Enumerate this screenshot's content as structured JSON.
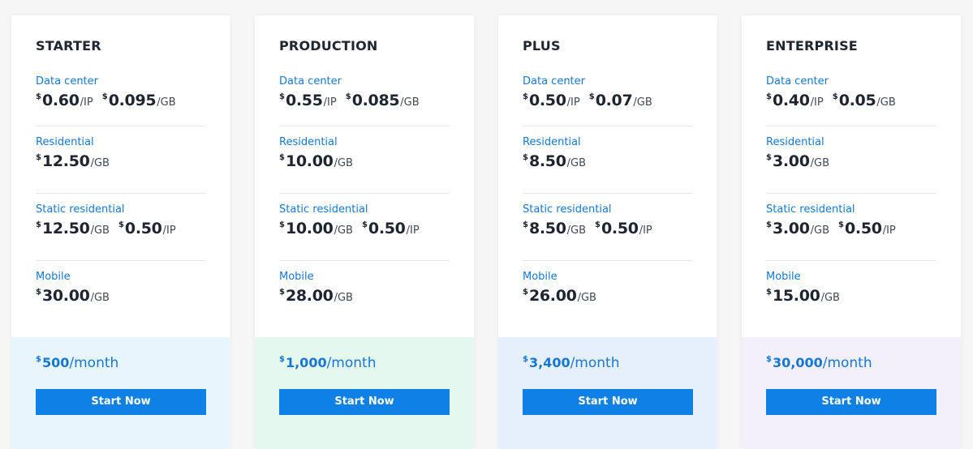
{
  "colors": {
    "accent": "#1677d2",
    "button": "#0f80e5",
    "starter_bg": "#e6f6fc",
    "production_bg": "#e5f8ef",
    "plus_bg": "#e6f0fb",
    "enterprise_bg": "#f3f0fc"
  },
  "plans": [
    {
      "name": "STARTER",
      "datacenter": {
        "label": "Data center",
        "p1": "0.60",
        "u1": "/IP",
        "p2": "0.095",
        "u2": "/GB"
      },
      "residential": {
        "label": "Residential",
        "p1": "12.50",
        "u1": "/GB"
      },
      "static": {
        "label": "Static residential",
        "p1": "12.50",
        "u1": "/GB",
        "p2": "0.50",
        "u2": "/IP"
      },
      "mobile": {
        "label": "Mobile",
        "p1": "30.00",
        "u1": "/GB"
      },
      "monthly": {
        "amount": "500",
        "period": "/month"
      },
      "button": "Start Now"
    },
    {
      "name": "PRODUCTION",
      "datacenter": {
        "label": "Data center",
        "p1": "0.55",
        "u1": "/IP",
        "p2": "0.085",
        "u2": "/GB"
      },
      "residential": {
        "label": "Residential",
        "p1": "10.00",
        "u1": "/GB"
      },
      "static": {
        "label": "Static residential",
        "p1": "10.00",
        "u1": "/GB",
        "p2": "0.50",
        "u2": "/IP"
      },
      "mobile": {
        "label": "Mobile",
        "p1": "28.00",
        "u1": "/GB"
      },
      "monthly": {
        "amount": "1,000",
        "period": "/month"
      },
      "button": "Start Now"
    },
    {
      "name": "PLUS",
      "datacenter": {
        "label": "Data center",
        "p1": "0.50",
        "u1": "/IP",
        "p2": "0.07",
        "u2": "/GB"
      },
      "residential": {
        "label": "Residential",
        "p1": "8.50",
        "u1": "/GB"
      },
      "static": {
        "label": "Static residential",
        "p1": "8.50",
        "u1": "/GB",
        "p2": "0.50",
        "u2": "/IP"
      },
      "mobile": {
        "label": "Mobile",
        "p1": "26.00",
        "u1": "/GB"
      },
      "monthly": {
        "amount": "3,400",
        "period": "/month"
      },
      "button": "Start Now"
    },
    {
      "name": "ENTERPRISE",
      "datacenter": {
        "label": "Data center",
        "p1": "0.40",
        "u1": "/IP",
        "p2": "0.05",
        "u2": "/GB"
      },
      "residential": {
        "label": "Residential",
        "p1": "3.00",
        "u1": "/GB"
      },
      "static": {
        "label": "Static residential",
        "p1": "3.00",
        "u1": "/GB",
        "p2": "0.50",
        "u2": "/IP"
      },
      "mobile": {
        "label": "Mobile",
        "p1": "15.00",
        "u1": "/GB"
      },
      "monthly": {
        "amount": "30,000",
        "period": "/month"
      },
      "button": "Start Now"
    }
  ],
  "currency_symbol": "$"
}
